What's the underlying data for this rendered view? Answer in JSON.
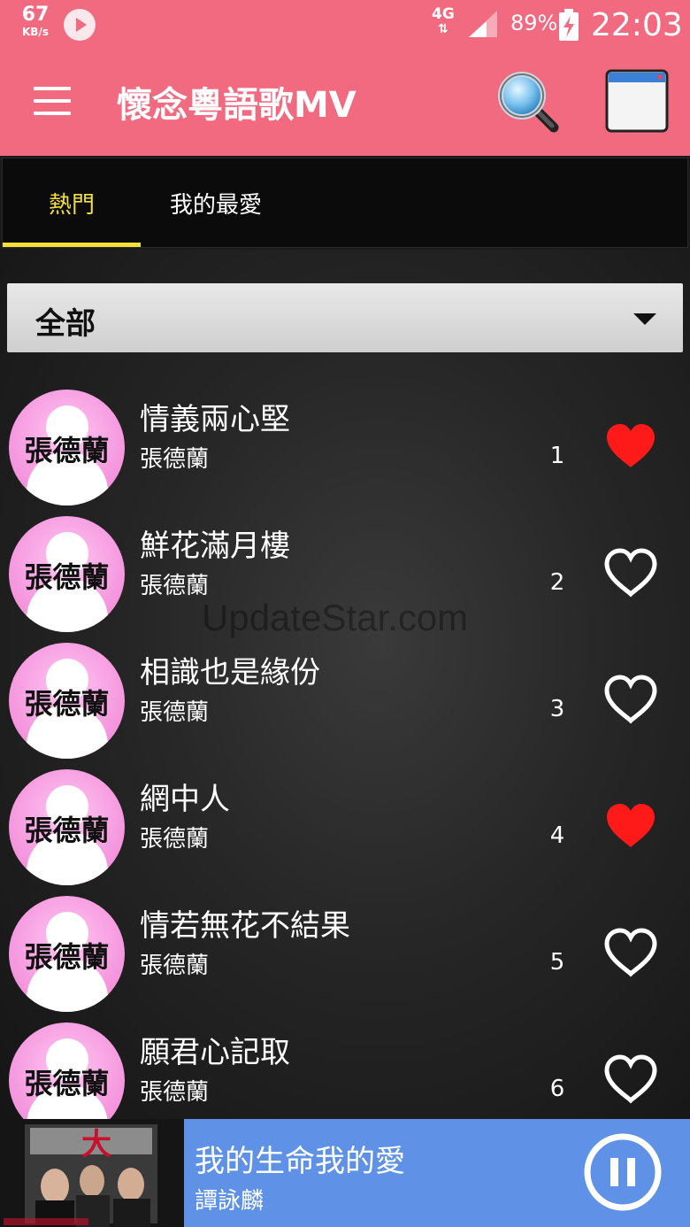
{
  "status_bar": {
    "net_speed": "67",
    "net_unit": "KB/s",
    "network": "4G",
    "battery_percent": "89%",
    "time": "22:03"
  },
  "app_bar": {
    "title": "懷念粵語歌MV",
    "icons": [
      "menu-icon",
      "search-icon",
      "window-icon"
    ]
  },
  "tabs": [
    {
      "label": "熱門",
      "active": true
    },
    {
      "label": "我的最愛",
      "active": false
    }
  ],
  "filter": {
    "selected": "全部"
  },
  "watermark": "UpdateStar.com",
  "songs": [
    {
      "title": "情義兩心堅",
      "artist": "張德蘭",
      "avatar_text": "張德蘭",
      "number": "1",
      "favorite": true
    },
    {
      "title": "鮮花滿月樓",
      "artist": "張德蘭",
      "avatar_text": "張德蘭",
      "number": "2",
      "favorite": false
    },
    {
      "title": "相識也是緣份",
      "artist": "張德蘭",
      "avatar_text": "張德蘭",
      "number": "3",
      "favorite": false
    },
    {
      "title": "網中人",
      "artist": "張德蘭",
      "avatar_text": "張德蘭",
      "number": "4",
      "favorite": true
    },
    {
      "title": "情若無花不結果",
      "artist": "張德蘭",
      "avatar_text": "張德蘭",
      "number": "5",
      "favorite": false
    },
    {
      "title": "願君心記取",
      "artist": "張德蘭",
      "avatar_text": "張德蘭",
      "number": "6",
      "favorite": false
    }
  ],
  "now_playing": {
    "title": "我的生命我的愛",
    "artist": "譚詠麟"
  },
  "colors": {
    "app_bar": "#f16a80",
    "tab_active": "#f5e13a",
    "heart_on": "#ff1a1a",
    "now_playing_bg": "#5f92e6"
  }
}
